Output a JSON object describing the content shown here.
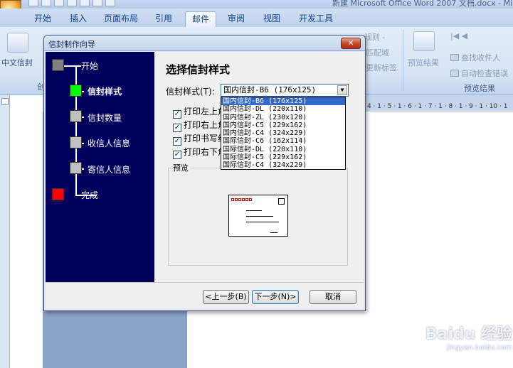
{
  "window": {
    "title": "新建 Microsoft Office Word 2007 文档.docx - Mi"
  },
  "ribbon": {
    "tabs": [
      {
        "label": "开始",
        "active": false
      },
      {
        "label": "插入",
        "active": false
      },
      {
        "label": "页面布局",
        "active": false
      },
      {
        "label": "引用",
        "active": false
      },
      {
        "label": "邮件",
        "active": true
      },
      {
        "label": "审阅",
        "active": false
      },
      {
        "label": "视图",
        "active": false
      },
      {
        "label": "开发工具",
        "active": false
      }
    ],
    "chinese_envelope": "中文信封",
    "group_create_fragment": "创",
    "rules_fragment": "规则 -",
    "match_fields_fragment": "匹配域",
    "update_labels_fragment": "更新标签",
    "preview_results": "预览结果",
    "find_recipient": "查找收件人",
    "auto_check_errors": "自动检查错误",
    "preview_group_label": "预览结果"
  },
  "ruler_top_text": "4 · 1 · 5 · 1 · 6 · 1 · 7 · 1 · 8 · 1 · 9 · 1 · 10 · 1",
  "watermark": {
    "brand": "Baidu 经验",
    "url": "jingyan.baidu.com"
  },
  "dialog": {
    "title": "信封制作向导",
    "close_symbol": "✕",
    "steps": [
      {
        "label": "开始",
        "state": "done",
        "color": "#808080"
      },
      {
        "label": "信封样式",
        "state": "current",
        "color": "#00ff00"
      },
      {
        "label": "信封数量",
        "state": "pending",
        "color": "#c0c0c0"
      },
      {
        "label": "收信人信息",
        "state": "pending",
        "color": "#c0c0c0"
      },
      {
        "label": "寄信人信息",
        "state": "pending",
        "color": "#c0c0c0"
      },
      {
        "label": "完成",
        "state": "end",
        "color": "#ff0000"
      }
    ],
    "heading": "选择信封样式",
    "style_label": "信封样式(T):",
    "selected_style": "国内信封-B6  (176x125)",
    "dropdown_arrow": "▼",
    "style_options": [
      "国内信封-B6  (176x125)",
      "国内信封-DL  (220x110)",
      "国内信封-ZL  (230x120)",
      "国内信封-C5  (229x162)",
      "国内信封-C4  (324x229)",
      "国际信封-C6  (162x114)",
      "国际信封-DL  (220x110)",
      "国际信封-C5  (229x162)",
      "国际信封-C4  (324x229)"
    ],
    "checkboxes": [
      {
        "label": "打印左上角",
        "checked": true
      },
      {
        "label": "打印右上角",
        "checked": true
      },
      {
        "label": "打印书写线",
        "checked": true
      },
      {
        "label": "打印右下角",
        "checked": true
      }
    ],
    "check_mark": "✓",
    "preview_label": "预览",
    "buttons": {
      "back": "<上一步(B)",
      "next": "下一步(N)>",
      "cancel": "取消"
    }
  }
}
